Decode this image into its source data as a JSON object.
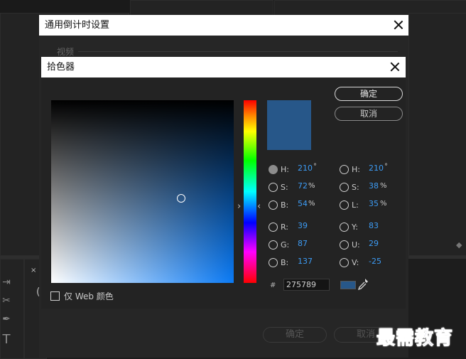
{
  "back_dialog": {
    "title": "通用倒计时设置",
    "section_label": "视频",
    "ok_label": "确定",
    "cancel_label": "取消"
  },
  "color_picker": {
    "title": "拾色器",
    "ok_label": "确定",
    "cancel_label": "取消",
    "selected_color": "#275789",
    "hsb": {
      "h_label": "H:",
      "h_value": "210",
      "h_unit": "°",
      "s_label": "S:",
      "s_value": "72",
      "s_unit": "%",
      "b_label": "B:",
      "b_value": "54",
      "b_unit": "%"
    },
    "hsl": {
      "h_label": "H:",
      "h_value": "210",
      "h_unit": "°",
      "s_label": "S:",
      "s_value": "38",
      "s_unit": "%",
      "l_label": "L:",
      "l_value": "35",
      "l_unit": "%"
    },
    "rgb": {
      "r_label": "R:",
      "r_value": "39",
      "g_label": "G:",
      "g_value": "87",
      "b_label": "B:",
      "b_value": "137"
    },
    "yuv": {
      "y_label": "Y:",
      "y_value": "83",
      "u_label": "U:",
      "u_value": "29",
      "v_label": "V:",
      "v_value": "-25"
    },
    "hex_label": "#",
    "hex_value": "275789",
    "web_only_label": "仅 Web 颜色",
    "hue_arrow_left": "›",
    "hue_arrow_right": "‹"
  },
  "background": {
    "tab_close": "×",
    "stray_char": "("
  },
  "watermark": "最需教育"
}
